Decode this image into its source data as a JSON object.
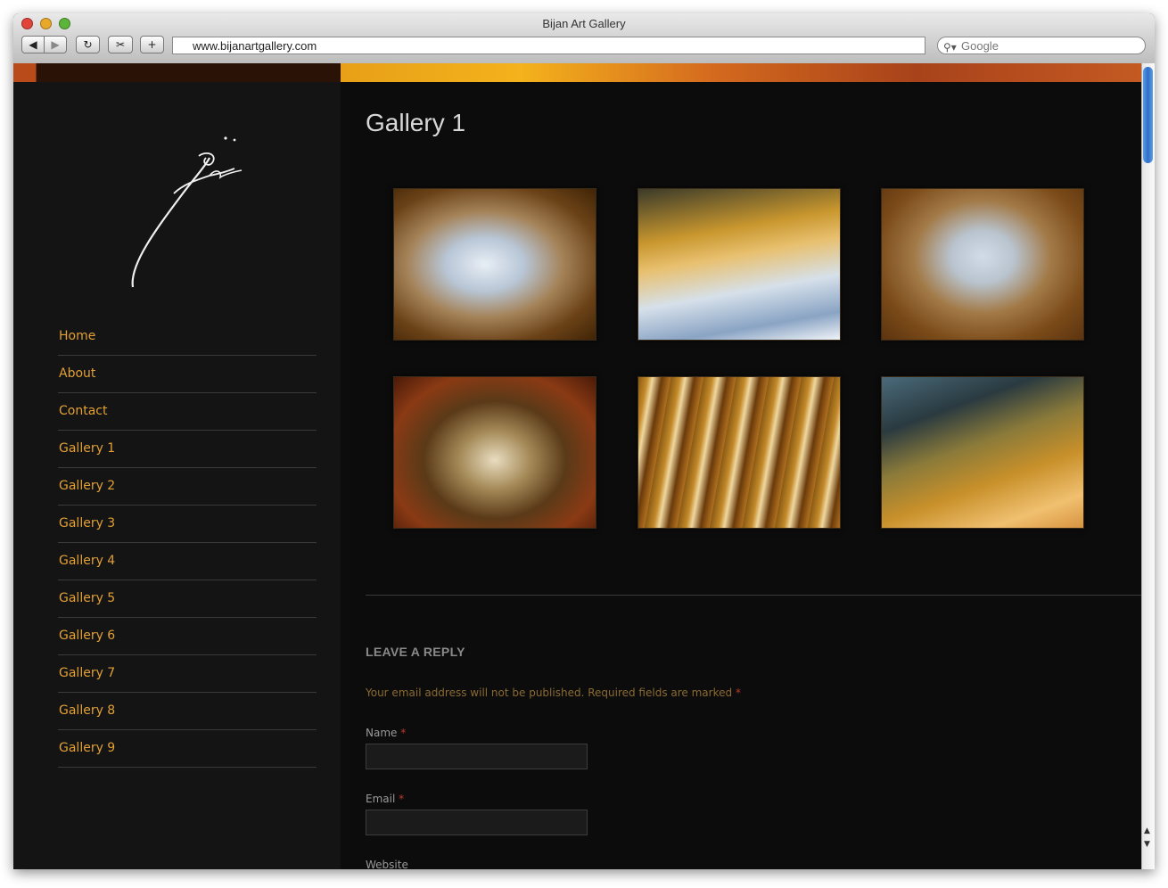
{
  "browser": {
    "title": "Bijan Art Gallery",
    "url": "www.bijanartgallery.com",
    "search_placeholder": "Google"
  },
  "nav": [
    "Home",
    "About",
    "Contact",
    "Gallery 1",
    "Gallery 2",
    "Gallery 3",
    "Gallery 4",
    "Gallery 5",
    "Gallery 6",
    "Gallery 7",
    "Gallery 8",
    "Gallery 9"
  ],
  "main": {
    "heading": "Gallery 1",
    "reply_heading": "LEAVE A REPLY",
    "reply_note": "Your email address will not be published. Required fields are marked",
    "required_mark": "*",
    "fields": {
      "name_label": "Name",
      "email_label": "Email",
      "website_label": "Website"
    }
  },
  "colors": {
    "accent": "#e2a035",
    "background": "#0f0f0f",
    "sidebar": "#141414",
    "banner_orange": "#f4b21c"
  }
}
